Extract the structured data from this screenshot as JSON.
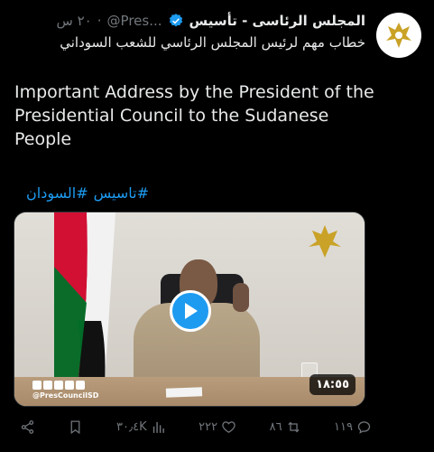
{
  "account": {
    "display_name": "المجلس الرئاسى - تأسيس",
    "handle": "@Pres...",
    "separator": "·",
    "time": "٢٠ س",
    "subtitle": "خطاب مهم لرئيس المجلس الرئاسي للشعب السوداني"
  },
  "tweet": {
    "body": "Important Address by the President of the Presidential Council to the Sudanese People",
    "hashtags": [
      "#تاسيس",
      "#السودان"
    ]
  },
  "media": {
    "duration": "١٨:٥٥",
    "watermark_handle": "@PresCouncilSD"
  },
  "actions": {
    "share": "",
    "views": "٣٠٫٤K",
    "likes": "٢٢٢",
    "reposts": "٨٦",
    "replies": "١١٩"
  },
  "colors": {
    "accent": "#1d9bf0",
    "muted": "#71767b",
    "text": "#e7e9ea",
    "bg": "#000000"
  }
}
